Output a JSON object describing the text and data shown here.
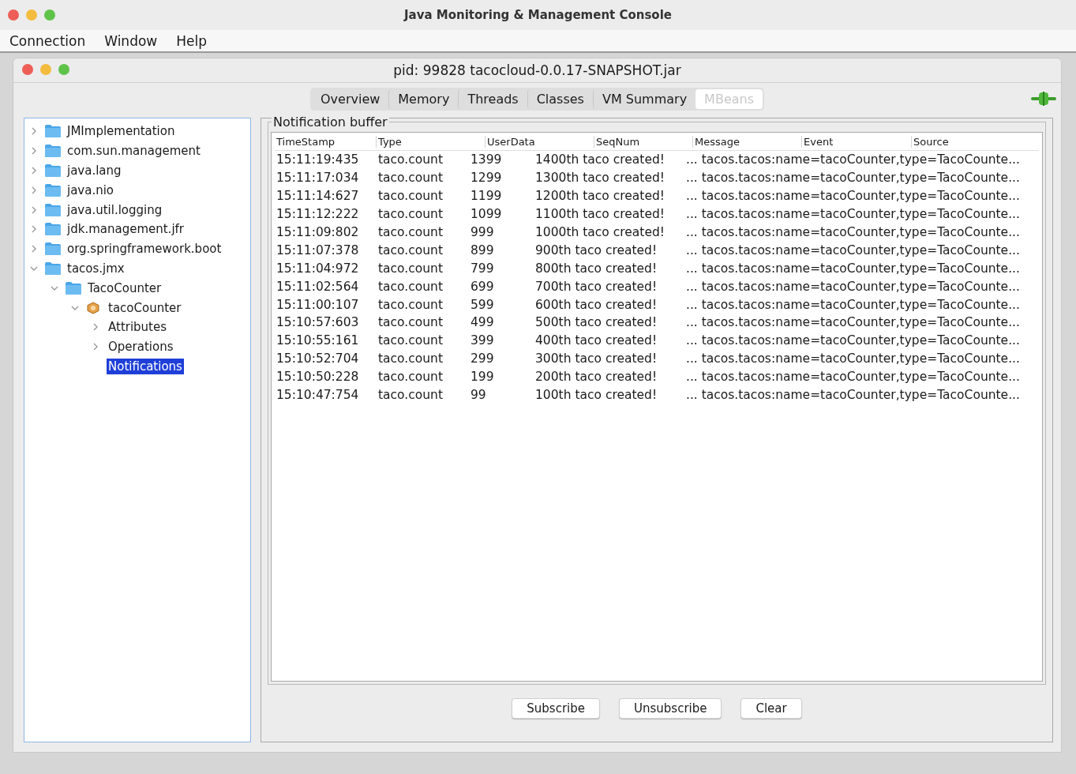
{
  "window": {
    "title": "Java Monitoring & Management Console"
  },
  "menu": [
    "Connection",
    "Window",
    "Help"
  ],
  "inner_window": {
    "title": "pid: 99828 tacocloud-0.0.17-SNAPSHOT.jar"
  },
  "tabs": [
    {
      "label": "Overview",
      "selected": false
    },
    {
      "label": "Memory",
      "selected": false
    },
    {
      "label": "Threads",
      "selected": false
    },
    {
      "label": "Classes",
      "selected": false
    },
    {
      "label": "VM Summary",
      "selected": false
    },
    {
      "label": "MBeans",
      "selected": true
    }
  ],
  "tree": [
    {
      "label": "JMImplementation",
      "kind": "folder",
      "expanded": false,
      "selected": false
    },
    {
      "label": "com.sun.management",
      "kind": "folder",
      "expanded": false,
      "selected": false
    },
    {
      "label": "java.lang",
      "kind": "folder",
      "expanded": false,
      "selected": false
    },
    {
      "label": "java.nio",
      "kind": "folder",
      "expanded": false,
      "selected": false
    },
    {
      "label": "java.util.logging",
      "kind": "folder",
      "expanded": false,
      "selected": false
    },
    {
      "label": "jdk.management.jfr",
      "kind": "folder",
      "expanded": false,
      "selected": false
    },
    {
      "label": "org.springframework.boot",
      "kind": "folder",
      "expanded": false,
      "selected": false
    },
    {
      "label": "tacos.jmx",
      "kind": "folder",
      "expanded": true,
      "selected": false,
      "children": [
        {
          "label": "TacoCounter",
          "kind": "folder",
          "expanded": true,
          "selected": false,
          "children": [
            {
              "label": "tacoCounter",
              "kind": "bean",
              "expanded": true,
              "selected": false,
              "children": [
                {
                  "label": "Attributes",
                  "expanded": false,
                  "selected": false
                },
                {
                  "label": "Operations",
                  "expanded": false,
                  "selected": false
                },
                {
                  "label": "Notifications",
                  "selected": true
                }
              ]
            }
          ]
        }
      ]
    }
  ],
  "notification_buffer": {
    "title": "Notification buffer",
    "columns": [
      "TimeStamp",
      "Type",
      "UserData",
      "SeqNum",
      "Message",
      "Event",
      "Source"
    ],
    "rows": [
      [
        "15:11:19:435",
        "taco.count",
        "1399",
        "1400th taco created!",
        "... tacos.tacos:name=tacoCounter,type=TacoCounte..."
      ],
      [
        "15:11:17:034",
        "taco.count",
        "1299",
        "1300th taco created!",
        "... tacos.tacos:name=tacoCounter,type=TacoCounte..."
      ],
      [
        "15:11:14:627",
        "taco.count",
        "1199",
        "1200th taco created!",
        "... tacos.tacos:name=tacoCounter,type=TacoCounte..."
      ],
      [
        "15:11:12:222",
        "taco.count",
        "1099",
        "1100th taco created!",
        "... tacos.tacos:name=tacoCounter,type=TacoCounte..."
      ],
      [
        "15:11:09:802",
        "taco.count",
        "999",
        "1000th taco created!",
        "... tacos.tacos:name=tacoCounter,type=TacoCounte..."
      ],
      [
        "15:11:07:378",
        "taco.count",
        "899",
        "900th taco created!",
        "... tacos.tacos:name=tacoCounter,type=TacoCounte..."
      ],
      [
        "15:11:04:972",
        "taco.count",
        "799",
        "800th taco created!",
        "... tacos.tacos:name=tacoCounter,type=TacoCounte..."
      ],
      [
        "15:11:02:564",
        "taco.count",
        "699",
        "700th taco created!",
        "... tacos.tacos:name=tacoCounter,type=TacoCounte..."
      ],
      [
        "15:11:00:107",
        "taco.count",
        "599",
        "600th taco created!",
        "... tacos.tacos:name=tacoCounter,type=TacoCounte..."
      ],
      [
        "15:10:57:603",
        "taco.count",
        "499",
        "500th taco created!",
        "... tacos.tacos:name=tacoCounter,type=TacoCounte..."
      ],
      [
        "15:10:55:161",
        "taco.count",
        "399",
        "400th taco created!",
        "... tacos.tacos:name=tacoCounter,type=TacoCounte..."
      ],
      [
        "15:10:52:704",
        "taco.count",
        "299",
        "300th taco created!",
        "... tacos.tacos:name=tacoCounter,type=TacoCounte..."
      ],
      [
        "15:10:50:228",
        "taco.count",
        "199",
        "200th taco created!",
        "... tacos.tacos:name=tacoCounter,type=TacoCounte..."
      ],
      [
        "15:10:47:754",
        "taco.count",
        "99",
        "100th taco created!",
        "... tacos.tacos:name=tacoCounter,type=TacoCounte..."
      ]
    ]
  },
  "buttons": [
    "Subscribe",
    "Unsubscribe",
    "Clear"
  ]
}
